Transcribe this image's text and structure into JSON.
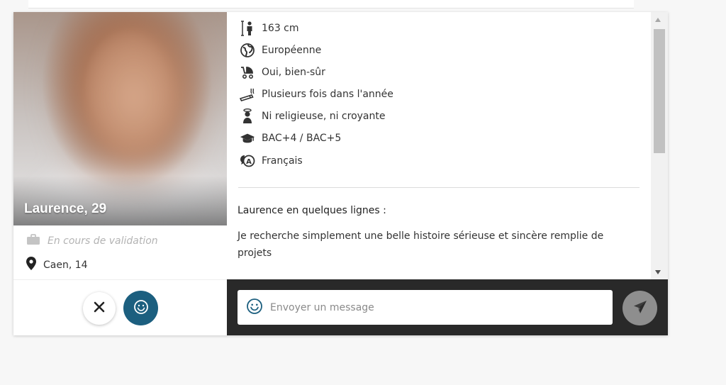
{
  "profile": {
    "name_age": "Laurence, 29",
    "job": "En cours de validation",
    "city": "Caen, 14"
  },
  "attributes": [
    {
      "icon": "height-icon",
      "label": "163 cm"
    },
    {
      "icon": "globe-icon",
      "label": "Européenne"
    },
    {
      "icon": "stroller-icon",
      "label": "Oui, bien-sûr"
    },
    {
      "icon": "cigarette-icon",
      "label": "Plusieurs fois dans l'année"
    },
    {
      "icon": "religion-icon",
      "label": "Ni religieuse, ni croyante"
    },
    {
      "icon": "graduation-cap-icon",
      "label": "BAC+4 / BAC+5"
    },
    {
      "icon": "language-icon",
      "label": "Français"
    }
  ],
  "about": {
    "title": "Laurence en quelques lignes :",
    "text": "Je recherche simplement une belle histoire sérieuse et sincère remplie de projets"
  },
  "chat": {
    "placeholder": "Envoyer un message"
  },
  "colors": {
    "like_button": "#1c5f7f",
    "chat_bar": "#292929",
    "send_button": "#8e8e8e"
  }
}
